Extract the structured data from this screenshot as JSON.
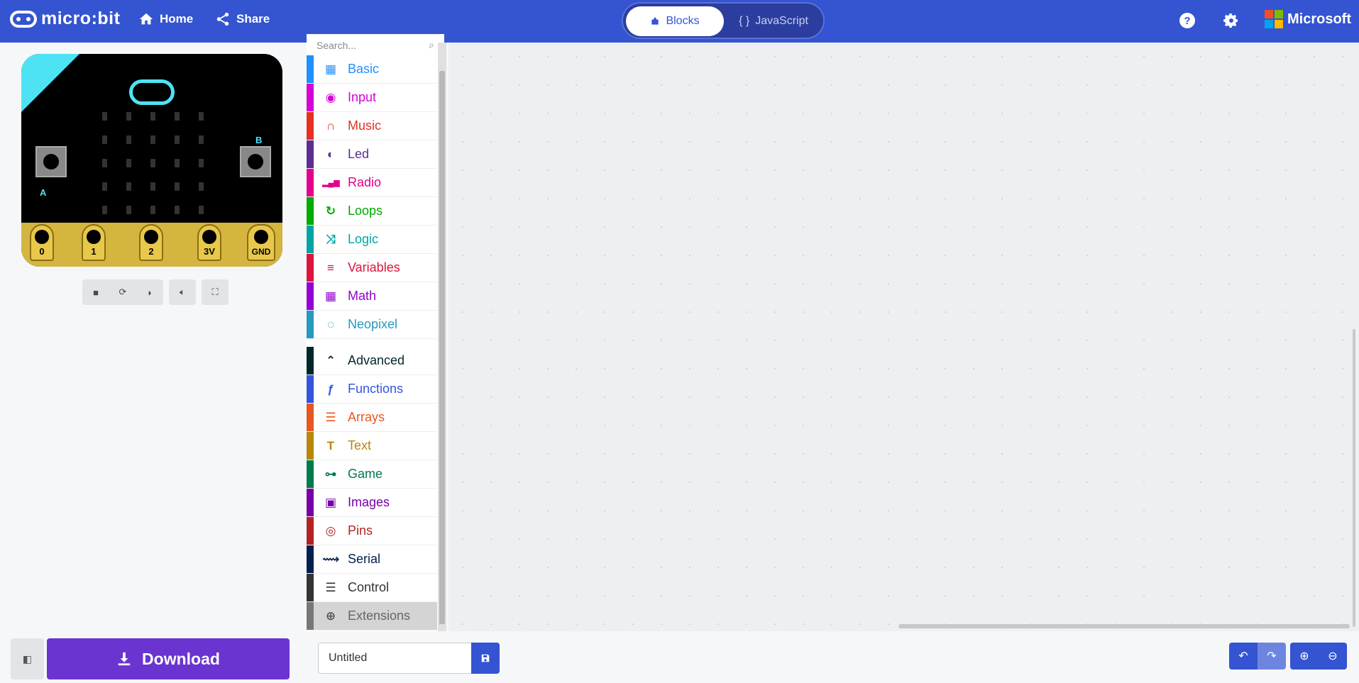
{
  "header": {
    "brand": "micro:bit",
    "nav": [
      {
        "label": "Home",
        "icon": "home-icon"
      },
      {
        "label": "Share",
        "icon": "share-icon"
      }
    ],
    "modes": {
      "blocks": "Blocks",
      "javascript": "JavaScript",
      "javascript_prefix": "{ }",
      "active": "Blocks"
    },
    "vendor": "Microsoft",
    "colors": {
      "bar": "#3454d1",
      "ms_red": "#f25022",
      "ms_green": "#7fba00",
      "ms_blue": "#00a4ef",
      "ms_yellow": "#ffb900"
    }
  },
  "simulator": {
    "pins": [
      "0",
      "1",
      "2",
      "3V",
      "GND"
    ],
    "button_a": "A",
    "button_b": "B",
    "controls": [
      "stop-icon",
      "restart-icon",
      "slow-motion-icon",
      "mute-icon",
      "fullscreen-icon"
    ]
  },
  "toolbox": {
    "search_placeholder": "Search...",
    "categories": [
      {
        "label": "Basic",
        "color": "#1e90ff",
        "icon": "grid-icon"
      },
      {
        "label": "Input",
        "color": "#d400d4",
        "icon": "target-icon"
      },
      {
        "label": "Music",
        "color": "#e63022",
        "icon": "headphones-icon"
      },
      {
        "label": "Led",
        "color": "#5c2d91",
        "icon": "toggle-icon"
      },
      {
        "label": "Radio",
        "color": "#e3008c",
        "icon": "signal-icon"
      },
      {
        "label": "Loops",
        "color": "#00aa00",
        "icon": "loop-icon"
      },
      {
        "label": "Logic",
        "color": "#00a4a6",
        "icon": "shuffle-icon"
      },
      {
        "label": "Variables",
        "color": "#dc143c",
        "icon": "lines-icon"
      },
      {
        "label": "Math",
        "color": "#9400d3",
        "icon": "calculator-icon"
      },
      {
        "label": "Neopixel",
        "color": "#2699bf",
        "icon": "ring-icon"
      }
    ],
    "advanced_categories": [
      {
        "label": "Advanced",
        "color": "#00272b",
        "icon": "chevron-up-icon"
      },
      {
        "label": "Functions",
        "color": "#3455db",
        "icon": "function-icon"
      },
      {
        "label": "Arrays",
        "color": "#e65722",
        "icon": "list-icon"
      },
      {
        "label": "Text",
        "color": "#b8860b",
        "icon": "text-icon"
      },
      {
        "label": "Game",
        "color": "#007a4b",
        "icon": "gamepad-icon"
      },
      {
        "label": "Images",
        "color": "#7600a8",
        "icon": "image-icon"
      },
      {
        "label": "Pins",
        "color": "#b22222",
        "icon": "pin-icon"
      },
      {
        "label": "Serial",
        "color": "#002050",
        "icon": "usb-icon"
      },
      {
        "label": "Control",
        "color": "#333333",
        "icon": "server-icon"
      },
      {
        "label": "Extensions",
        "color": "#777777",
        "icon": "plus-circle-icon"
      }
    ]
  },
  "footer": {
    "download_label": "Download",
    "project_name": "Untitled"
  }
}
